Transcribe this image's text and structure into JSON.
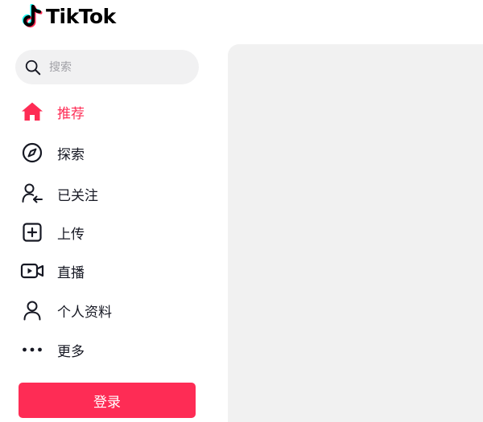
{
  "brand": {
    "name": "TikTok"
  },
  "search": {
    "placeholder": "搜索",
    "value": ""
  },
  "nav": {
    "items": [
      {
        "label": "推荐",
        "icon": "home-icon",
        "active": true
      },
      {
        "label": "探索",
        "icon": "compass-icon",
        "active": false
      },
      {
        "label": "已关注",
        "icon": "following-icon",
        "active": false
      },
      {
        "label": "上传",
        "icon": "upload-icon",
        "active": false
      },
      {
        "label": "直播",
        "icon": "live-icon",
        "active": false
      },
      {
        "label": "个人资料",
        "icon": "profile-icon",
        "active": false
      },
      {
        "label": "更多",
        "icon": "more-icon",
        "active": false
      }
    ]
  },
  "login": {
    "label": "登录"
  },
  "colors": {
    "accent": "#fe2c55",
    "text": "#161823",
    "panel": "#f1f1f1"
  }
}
